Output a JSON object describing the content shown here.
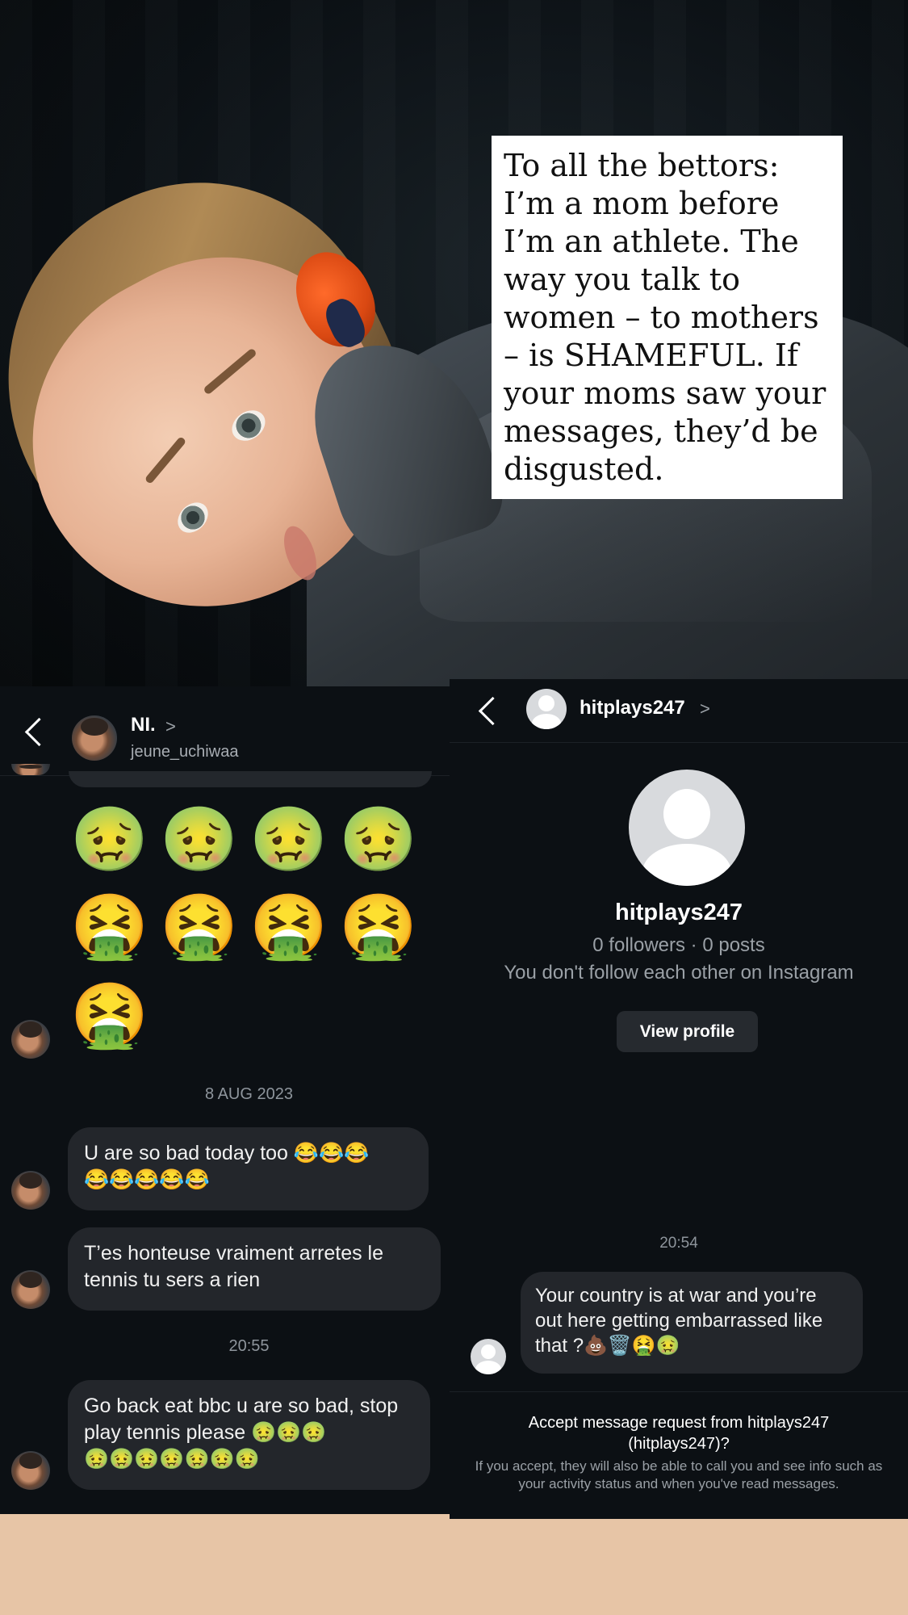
{
  "quote": {
    "text": "To all the bettors: I’m a mom before I’m an athlete. The way you talk to women – to mothers – is SHAMEFUL. If your moms saw your messages, they’d be disgusted."
  },
  "left_chat": {
    "contact_name": "NI.",
    "chevron": ">",
    "username": "jeune_uchiwaa",
    "emoji_rows": [
      "🤢🤢🤢🤢",
      "🤮🤮🤮🤮",
      "🤮"
    ],
    "date_separator": "8 AUG 2023",
    "messages": [
      "U are so bad today too 😂😂😂\n😂😂😂😂😂",
      "T’es honteuse vraiment arretes le tennis tu sers a rien"
    ],
    "time_separator": "20:55",
    "last_message": "Go back eat bbc u are so bad, stop play tennis please 🤢🤢🤢\n🤢🤢🤢🤢🤢🤢🤢"
  },
  "right_chat": {
    "title": "hitplays247",
    "chevron": ">",
    "profile_name": "hitplays247",
    "profile_stats": "0 followers · 0 posts",
    "profile_follow_status": "You don't follow each other on Instagram",
    "view_profile_label": "View profile",
    "time_separator": "20:54",
    "message": "Your country is at war and you’re out here getting embarrassed like that ?💩🗑️🤮🤢",
    "accept_title": "Accept message request from hitplays247 (hitplays247)?",
    "accept_info": "If you accept, they will also be able to call you and see info such as your activity status and when you've read messages."
  }
}
